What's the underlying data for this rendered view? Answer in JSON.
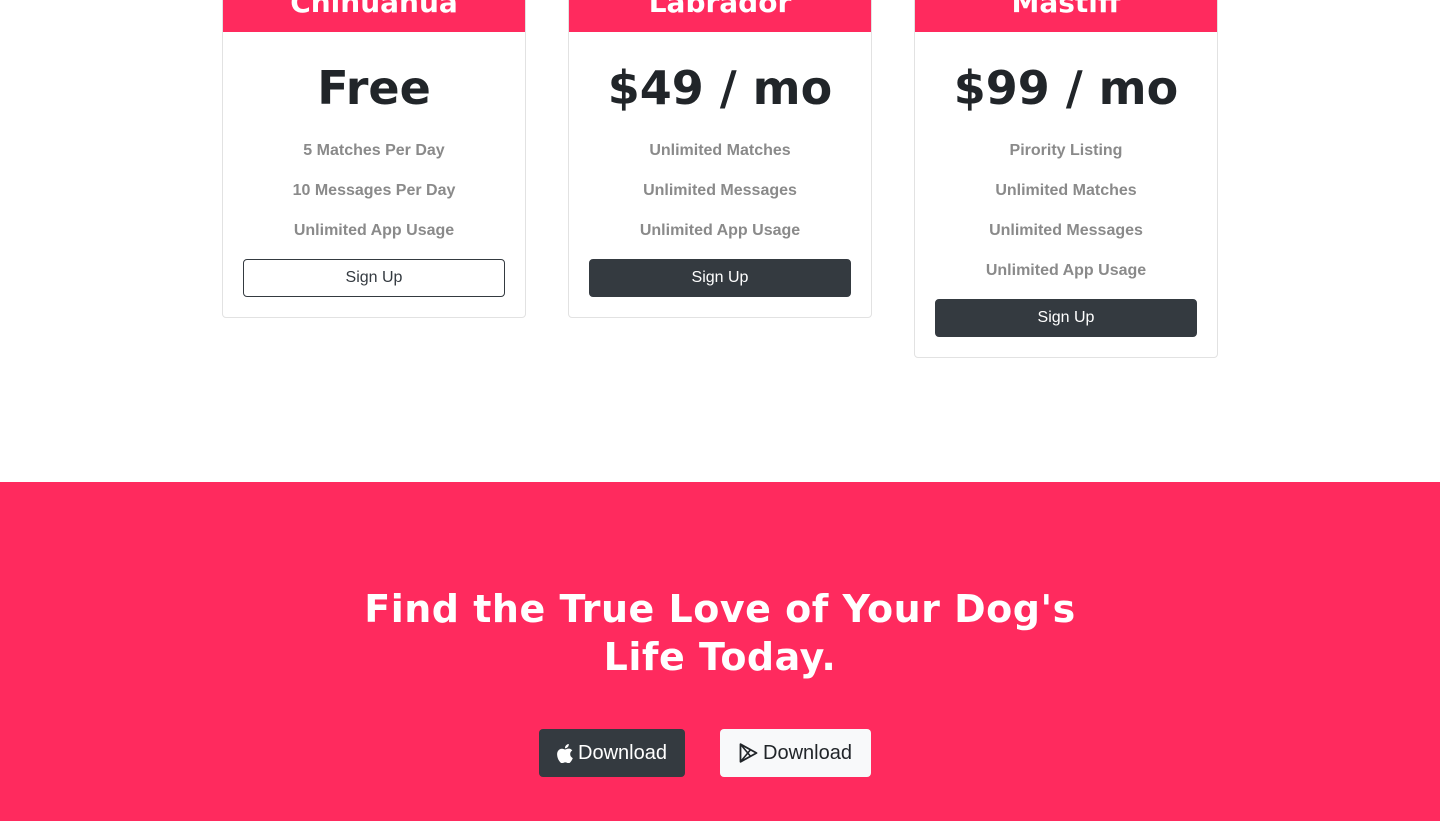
{
  "plans": [
    {
      "name": "Chihuahua",
      "price": "Free",
      "features": [
        "5 Matches Per Day",
        "10 Messages Per Day",
        "Unlimited App Usage"
      ],
      "button_label": "Sign Up",
      "button_style": "outline"
    },
    {
      "name": "Labrador",
      "price": "$49 / mo",
      "features": [
        "Unlimited Matches",
        "Unlimited Messages",
        "Unlimited App Usage"
      ],
      "button_label": "Sign Up",
      "button_style": "dark"
    },
    {
      "name": "Mastiff",
      "price": "$99 / mo",
      "features": [
        "Pirority Listing",
        "Unlimited Matches",
        "Unlimited Messages",
        "Unlimited App Usage"
      ],
      "button_label": "Sign Up",
      "button_style": "dark"
    }
  ],
  "cta": {
    "title_line1": "Find the True Love of Your Dog's",
    "title_line2": "Life Today.",
    "apple_download_label": "Download",
    "play_download_label": "Download",
    "apple_icon": "apple-icon",
    "play_icon": "google-play-icon"
  },
  "colors": {
    "brand": "#ff2a5e",
    "dark": "#343a40",
    "muted_text": "#8a8a8a"
  }
}
